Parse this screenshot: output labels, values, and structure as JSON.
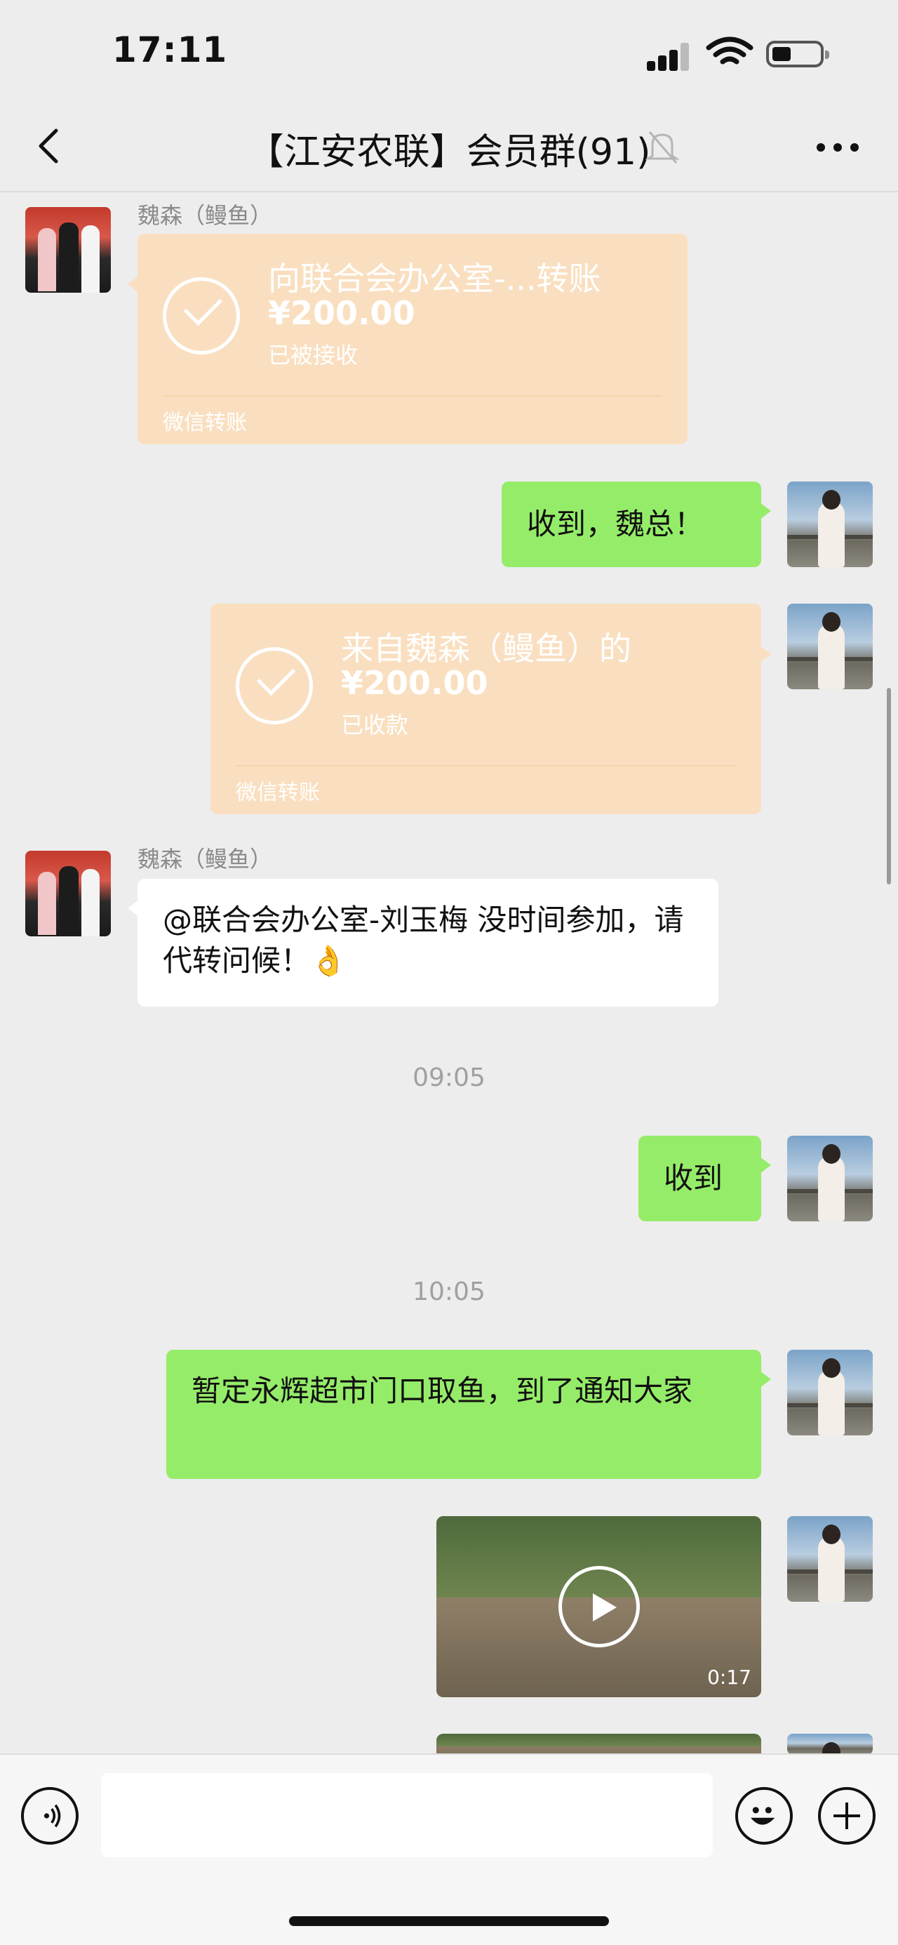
{
  "status_bar": {
    "time": "17:11"
  },
  "header": {
    "title": "【江安农联】会员群(91)"
  },
  "messages": [
    {
      "type": "transfer",
      "side": "left",
      "sender": "魏森（鳗鱼）",
      "title": "向联合会办公室-...转账",
      "amount": "¥200.00",
      "status": "已被接收",
      "footer": "微信转账"
    },
    {
      "type": "text",
      "side": "right",
      "text": "收到，魏总！"
    },
    {
      "type": "transfer",
      "side": "right",
      "title": "来自魏森（鳗鱼）的",
      "amount": "¥200.00",
      "status": "已收款",
      "footer": "微信转账"
    },
    {
      "type": "text",
      "side": "left",
      "sender": "魏森（鳗鱼）",
      "text": "@联合会办公室-刘玉梅 没时间参加，请代转问候！👌"
    },
    {
      "type": "time",
      "text": "09:05"
    },
    {
      "type": "text",
      "side": "right",
      "text": "收到"
    },
    {
      "type": "time",
      "text": "10:05"
    },
    {
      "type": "text",
      "side": "right",
      "text": "暂定永辉超市门口取鱼，到了通知大家"
    },
    {
      "type": "video",
      "side": "right",
      "duration": "0:17"
    }
  ]
}
